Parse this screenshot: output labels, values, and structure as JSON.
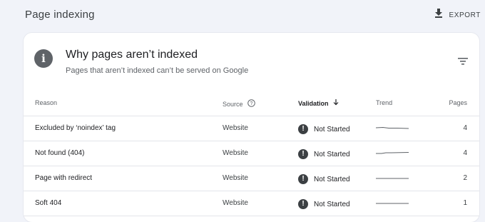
{
  "header": {
    "title": "Page indexing",
    "export_label": "EXPORT"
  },
  "card": {
    "title": "Why pages aren’t indexed",
    "subtitle": "Pages that aren’t indexed can’t be served on Google",
    "icon": "info-icon"
  },
  "table": {
    "columns": {
      "reason": "Reason",
      "source": "Source",
      "validation": "Validation",
      "trend": "Trend",
      "pages": "Pages"
    },
    "rows": [
      {
        "reason": "Excluded by ‘noindex’ tag",
        "source": "Website",
        "validation": "Not Started",
        "pages": "4"
      },
      {
        "reason": "Not found (404)",
        "source": "Website",
        "validation": "Not Started",
        "pages": "4"
      },
      {
        "reason": "Page with redirect",
        "source": "Website",
        "validation": "Not Started",
        "pages": "2"
      },
      {
        "reason": "Soft 404",
        "source": "Website",
        "validation": "Not Started",
        "pages": "1"
      }
    ]
  },
  "colors": {
    "background": "#f1f3f9",
    "status_icon": "#3c4043",
    "text": "#202124"
  }
}
